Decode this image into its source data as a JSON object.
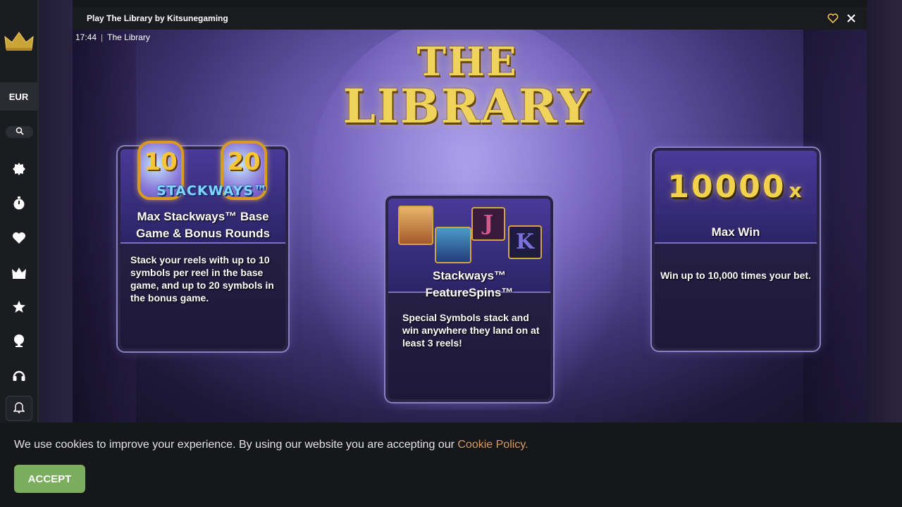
{
  "sidebar": {
    "currency": "EUR",
    "icons": [
      "crown-logo-icon",
      "search-icon",
      "new-games-icon",
      "timer-icon",
      "heart-icon",
      "crown-icon",
      "star-icon",
      "trophy-icon",
      "headset-icon",
      "bell-icon"
    ]
  },
  "game": {
    "window_title": "Play The Library by Kitsunegaming",
    "clock_time": "17:44",
    "game_name": "The Library",
    "logo_line1": "THE",
    "logo_line2": "LIBRARY",
    "panels": [
      {
        "badge_left": "10",
        "badge_right": "20",
        "badge_caption": "STACKWAYS™",
        "title": "Max Stackways™ Base Game & Bonus Rounds",
        "body": "Stack your reels with up to 10 symbols per reel in the base game, and up to 20 symbols in the bonus game."
      },
      {
        "symbol_j": "J",
        "symbol_k": "K",
        "title": "Stackways™ FeatureSpins™",
        "body": "Special Symbols stack and win anywhere they land on at least 3 reels!"
      },
      {
        "multiplier": "10000",
        "multiplier_suffix": "x",
        "title": "Max Win",
        "body": "Win up to 10,000 times your bet."
      }
    ]
  },
  "cookie": {
    "text": "We use cookies to improve your experience. By using our website you are accepting our",
    "link": "Cookie Policy.",
    "accept_label": "ACCEPT"
  },
  "colors": {
    "accept_green": "#7aad5e",
    "link_orange": "#d59a63",
    "gold": "#f0d35a"
  }
}
